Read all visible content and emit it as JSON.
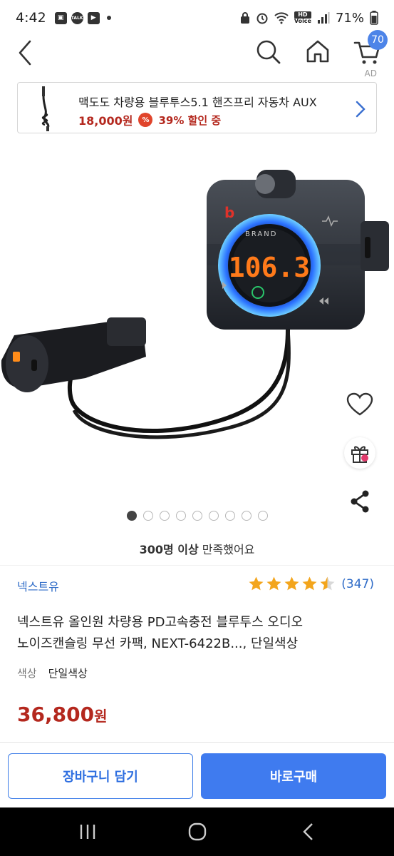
{
  "status_bar": {
    "time": "4:42",
    "battery": "71%",
    "hd_label": "HD",
    "voice_label": "Voice"
  },
  "header": {
    "cart_count": "70",
    "ad_label": "AD"
  },
  "ad_banner": {
    "title": "맥도도 차량용 블루투스5.1 핸즈프리 자동차 AUX",
    "price": "18,000원",
    "discount": "39% 할인 중",
    "discount_icon": "%"
  },
  "product_image": {
    "brand_mark": "BRAND",
    "display_value": "106.3",
    "logo_letter": "b"
  },
  "carousel": {
    "total": 9,
    "active_index": 0
  },
  "satisfaction": {
    "highlight": "300명 이상",
    "rest": " 만족했어요"
  },
  "product": {
    "brand": "넥스트유",
    "rating": 4.5,
    "review_count": "(347)",
    "title_line1": "넥스트유 올인원 차량용 PD고속충전 블루투스 오디오",
    "title_line2": "노이즈캔슬링 무선 카팩, NEXT-6422B..., 단일색상",
    "option_label": "색상",
    "option_value": "단일색상",
    "price_number": "36,800",
    "price_unit": "원"
  },
  "actions": {
    "add_to_cart": "장바구니 담기",
    "buy_now": "바로구매"
  },
  "colors": {
    "accent": "#3f7bef",
    "price": "#b4281e",
    "link": "#2e6bc7",
    "star": "#f3a51c"
  }
}
